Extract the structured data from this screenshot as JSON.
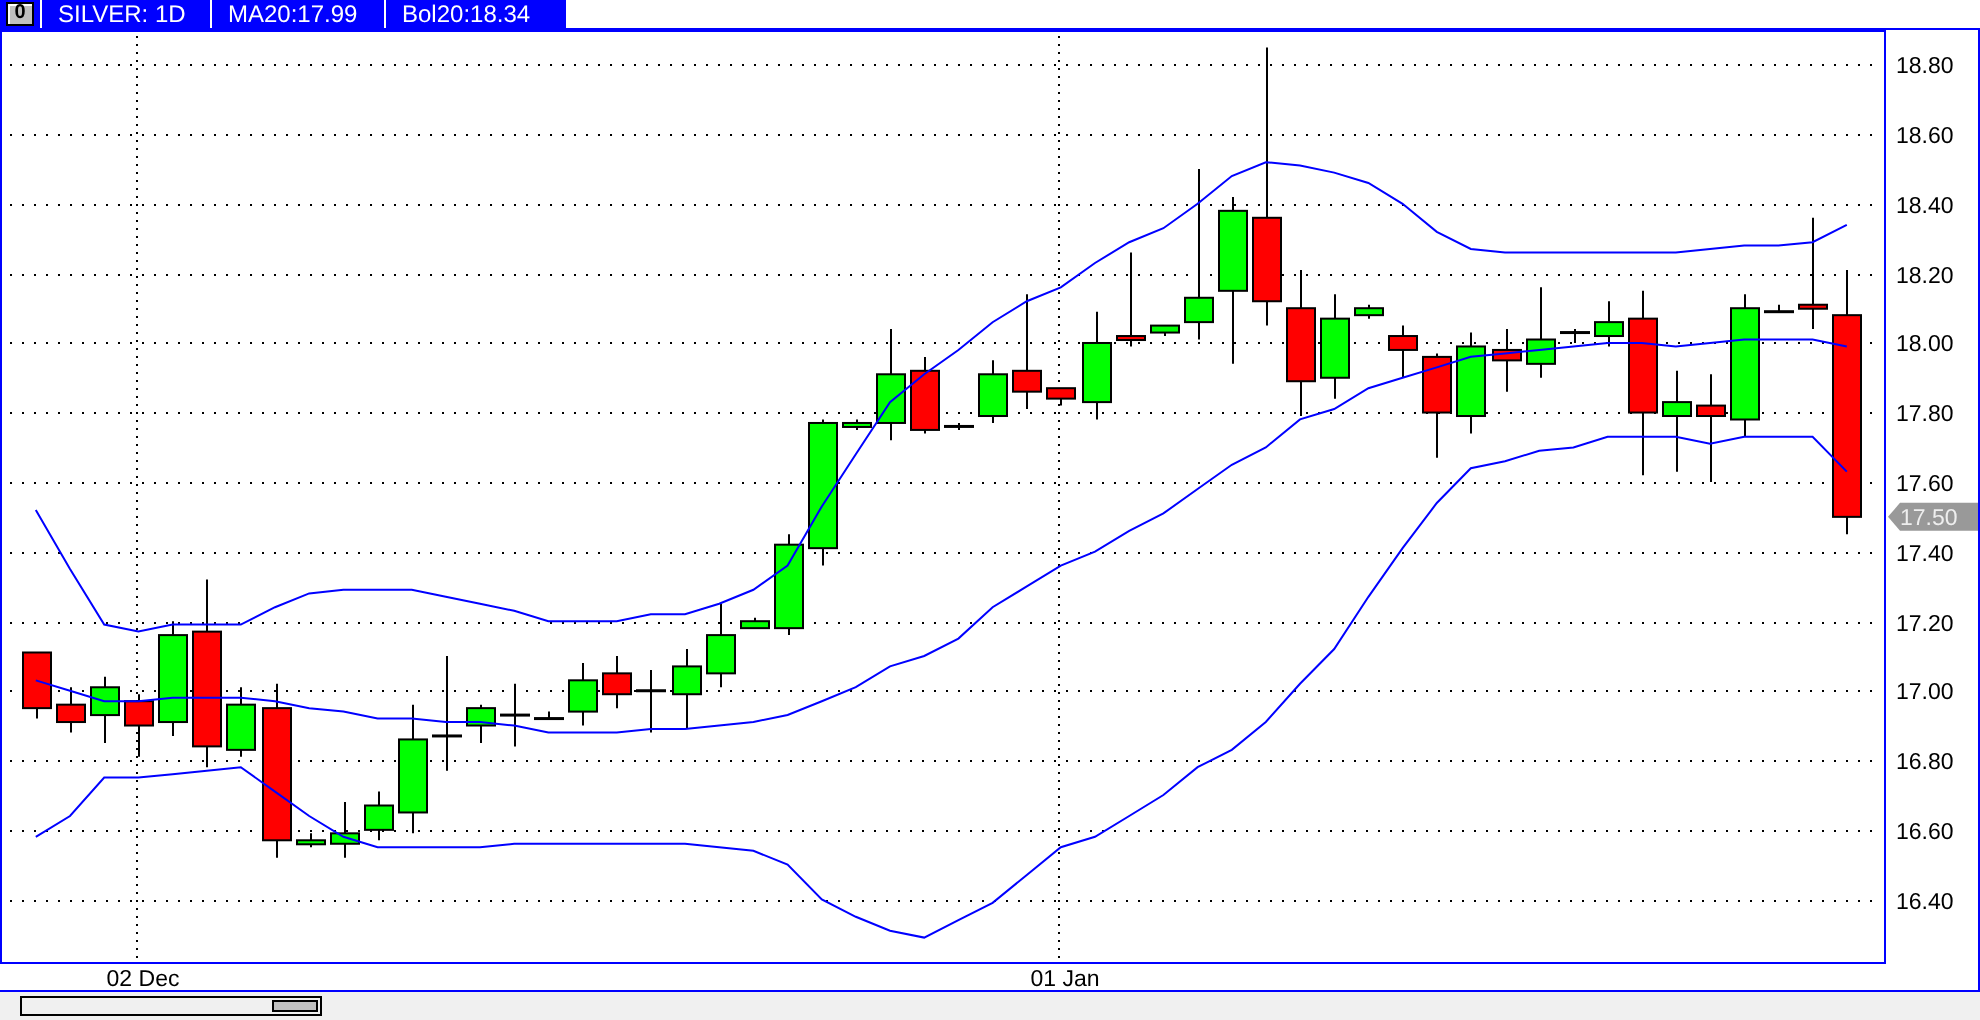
{
  "header": {
    "button": "0",
    "items": [
      "SILVER: 1D",
      "MA20:17.99",
      "Bol20:18.34"
    ]
  },
  "chart": {
    "last_price": "17.50",
    "chart_data": {
      "type": "candlestick",
      "categories": [
        null,
        null,
        null,
        "02 Dec",
        null,
        null,
        null,
        null,
        null,
        null,
        null,
        null,
        null,
        null,
        null,
        null,
        null,
        null,
        null,
        null,
        null,
        null,
        null,
        null,
        null,
        null,
        null,
        null,
        null,
        null,
        "01 Jan",
        null,
        null,
        null,
        null,
        null,
        null,
        null,
        null,
        null,
        null,
        null,
        null,
        null,
        null,
        null,
        null,
        null,
        null,
        null,
        null,
        null,
        null,
        null
      ],
      "ylim": [
        16.22,
        18.9
      ],
      "grid": true,
      "yticks": [
        {
          "value": 18.8,
          "label": "18.80"
        },
        {
          "value": 18.6,
          "label": "18.60"
        },
        {
          "value": 18.4,
          "label": "18.40"
        },
        {
          "value": 18.2,
          "label": "18.20"
        },
        {
          "value": 18.0,
          "label": "18.00"
        },
        {
          "value": 17.8,
          "label": "17.80"
        },
        {
          "value": 17.6,
          "label": "17.60"
        },
        {
          "value": 17.4,
          "label": "17.40"
        },
        {
          "value": 17.2,
          "label": "17.20"
        },
        {
          "value": 17.0,
          "label": "17.00"
        },
        {
          "value": 16.8,
          "label": "16.80"
        },
        {
          "value": 16.6,
          "label": "16.60"
        },
        {
          "value": 16.4,
          "label": "16.40"
        }
      ],
      "ohlc": [
        [
          17.11,
          17.11,
          16.92,
          16.95
        ],
        [
          16.96,
          17.01,
          16.88,
          16.91
        ],
        [
          16.93,
          17.04,
          16.85,
          17.01
        ],
        [
          16.97,
          16.99,
          16.81,
          16.9
        ],
        [
          16.91,
          17.2,
          16.87,
          17.16
        ],
        [
          17.17,
          17.32,
          16.78,
          16.84
        ],
        [
          16.83,
          17.01,
          16.81,
          16.96
        ],
        [
          16.95,
          17.02,
          16.52,
          16.57
        ],
        [
          16.56,
          16.59,
          16.55,
          16.57
        ],
        [
          16.56,
          16.68,
          16.52,
          16.59
        ],
        [
          16.6,
          16.71,
          16.57,
          16.67
        ],
        [
          16.65,
          16.96,
          16.59,
          16.86
        ],
        [
          16.87,
          17.1,
          16.77,
          16.87
        ],
        [
          16.9,
          16.96,
          16.85,
          16.95
        ],
        [
          16.93,
          17.02,
          16.84,
          16.93
        ],
        [
          16.92,
          16.94,
          16.92,
          16.92
        ],
        [
          16.94,
          17.08,
          16.9,
          17.03
        ],
        [
          17.05,
          17.1,
          16.95,
          16.99
        ],
        [
          17.0,
          17.06,
          16.88,
          17.0
        ],
        [
          16.99,
          17.12,
          16.89,
          17.07
        ],
        [
          17.05,
          17.25,
          17.01,
          17.16
        ],
        [
          17.18,
          17.21,
          17.18,
          17.2
        ],
        [
          17.18,
          17.45,
          17.16,
          17.42
        ],
        [
          17.41,
          17.78,
          17.36,
          17.77
        ],
        [
          17.76,
          17.78,
          17.75,
          17.77
        ],
        [
          17.77,
          18.04,
          17.72,
          17.91
        ],
        [
          17.92,
          17.96,
          17.74,
          17.75
        ],
        [
          17.76,
          17.77,
          17.75,
          17.76
        ],
        [
          17.79,
          17.95,
          17.77,
          17.91
        ],
        [
          17.92,
          18.14,
          17.81,
          17.86
        ],
        [
          17.87,
          17.87,
          17.82,
          17.84
        ],
        [
          17.83,
          18.09,
          17.78,
          18.0
        ],
        [
          18.02,
          18.26,
          17.99,
          18.01
        ],
        [
          18.03,
          18.05,
          18.02,
          18.05
        ],
        [
          18.06,
          18.5,
          18.01,
          18.13
        ],
        [
          18.15,
          18.42,
          17.94,
          18.38
        ],
        [
          18.36,
          18.85,
          18.05,
          18.12
        ],
        [
          18.1,
          18.21,
          17.79,
          17.89
        ],
        [
          17.9,
          18.14,
          17.84,
          18.07
        ],
        [
          18.08,
          18.11,
          18.07,
          18.1
        ],
        [
          18.02,
          18.05,
          17.9,
          17.98
        ],
        [
          17.96,
          17.97,
          17.67,
          17.8
        ],
        [
          17.79,
          18.03,
          17.74,
          17.99
        ],
        [
          17.98,
          18.04,
          17.86,
          17.95
        ],
        [
          17.94,
          18.16,
          17.9,
          18.01
        ],
        [
          18.03,
          18.04,
          18.0,
          18.03
        ],
        [
          18.02,
          18.12,
          17.99,
          18.06
        ],
        [
          18.07,
          18.15,
          17.62,
          17.8
        ],
        [
          17.79,
          17.92,
          17.63,
          17.83
        ],
        [
          17.82,
          17.91,
          17.6,
          17.79
        ],
        [
          17.78,
          18.14,
          17.73,
          18.1
        ],
        [
          18.09,
          18.11,
          18.09,
          18.09
        ],
        [
          18.11,
          18.36,
          18.04,
          18.1
        ],
        [
          18.08,
          18.21,
          17.45,
          17.5
        ]
      ],
      "series": [
        {
          "type": "line",
          "color": "#0000ff",
          "values": [
            17.03,
            17.0,
            16.97,
            16.97,
            16.98,
            16.98,
            16.98,
            16.97,
            16.95,
            16.94,
            16.92,
            16.92,
            16.91,
            16.91,
            16.9,
            16.88,
            16.88,
            16.88,
            16.89,
            16.89,
            16.9,
            16.91,
            16.93,
            16.97,
            17.01,
            17.07,
            17.1,
            17.15,
            17.24,
            17.3,
            17.36,
            17.4,
            17.46,
            17.51,
            17.58,
            17.65,
            17.7,
            17.78,
            17.81,
            17.87,
            17.9,
            17.93,
            17.96,
            17.97,
            17.98,
            17.99,
            18.0,
            18.0,
            17.99,
            18.0,
            18.01,
            18.01,
            18.01,
            17.99
          ]
        },
        {
          "type": "line",
          "color": "#0000ff",
          "values": [
            17.52,
            17.35,
            17.19,
            17.17,
            17.19,
            17.19,
            17.19,
            17.24,
            17.28,
            17.29,
            17.29,
            17.29,
            17.27,
            17.25,
            17.23,
            17.2,
            17.2,
            17.2,
            17.22,
            17.22,
            17.25,
            17.29,
            17.36,
            17.53,
            17.68,
            17.83,
            17.91,
            17.98,
            18.06,
            18.12,
            18.16,
            18.23,
            18.29,
            18.33,
            18.4,
            18.48,
            18.52,
            18.51,
            18.49,
            18.46,
            18.4,
            18.32,
            18.27,
            18.26,
            18.26,
            18.26,
            18.26,
            18.26,
            18.26,
            18.27,
            18.28,
            18.28,
            18.29,
            18.34
          ]
        },
        {
          "type": "line",
          "color": "#0000ff",
          "values": [
            16.58,
            16.64,
            16.75,
            16.75,
            16.76,
            16.77,
            16.78,
            16.71,
            16.64,
            16.58,
            16.55,
            16.55,
            16.55,
            16.55,
            16.56,
            16.56,
            16.56,
            16.56,
            16.56,
            16.56,
            16.55,
            16.54,
            16.5,
            16.4,
            16.35,
            16.31,
            16.29,
            16.34,
            16.39,
            16.47,
            16.55,
            16.58,
            16.64,
            16.7,
            16.78,
            16.83,
            16.91,
            17.02,
            17.12,
            17.27,
            17.41,
            17.54,
            17.64,
            17.66,
            17.69,
            17.7,
            17.73,
            17.73,
            17.73,
            17.71,
            17.73,
            17.73,
            17.73,
            17.63
          ]
        }
      ]
    }
  }
}
